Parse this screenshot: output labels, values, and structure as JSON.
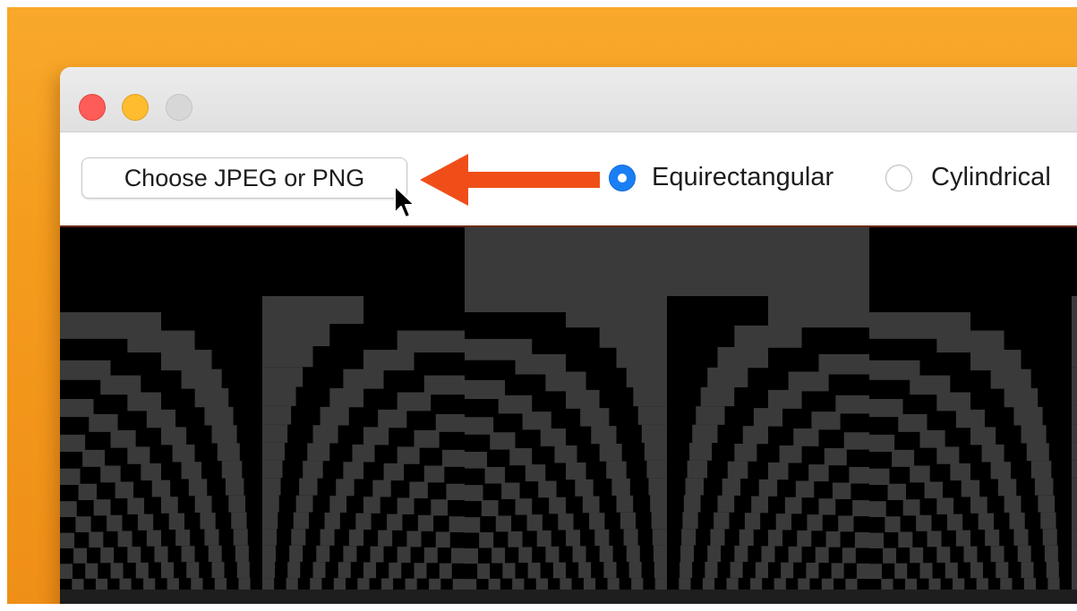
{
  "window": {
    "controls": [
      "close",
      "minimize",
      "zoom"
    ]
  },
  "toolbar": {
    "choose_button_label": "Choose JPEG or PNG",
    "projection_options": [
      {
        "label": "Equirectangular",
        "selected": true
      },
      {
        "label": "Cylindrical",
        "selected": false
      }
    ]
  },
  "annotation": {
    "arrow_color": "#f04e19"
  },
  "colors": {
    "accent": "#1a7ff5",
    "desktop": "#f49b1d",
    "checker_dark": "#000000",
    "checker_light": "#3a3a3a"
  }
}
